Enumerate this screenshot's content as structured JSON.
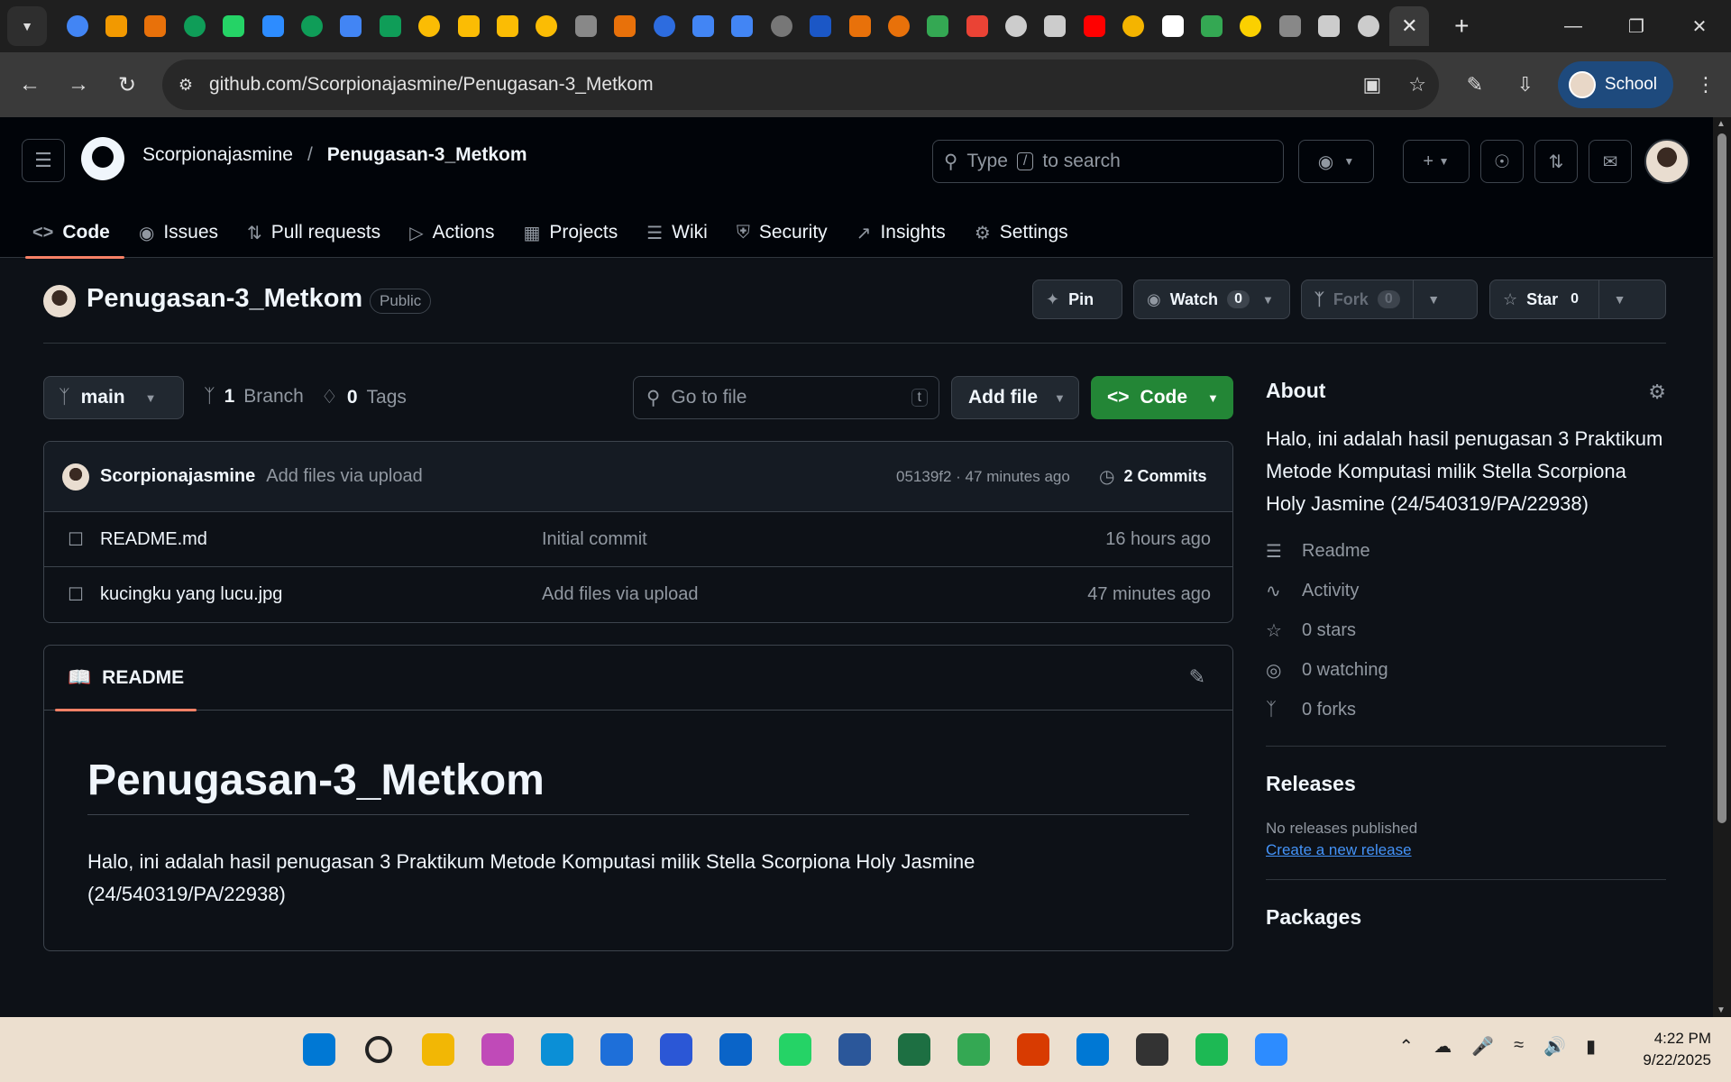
{
  "browser": {
    "url": "github.com/Scorpionajasmine/Penugasan-3_Metkom",
    "profile_label": "School",
    "tab_favicon_colors": [
      "#4285f4",
      "#f29900",
      "#e8710a",
      "#0f9d58",
      "#25d366",
      "#2d8cff",
      "#0f9d58",
      "#4285f4",
      "#0f9d58",
      "#fbbc04",
      "#fbbc04",
      "#fbbc04",
      "#fbbc04",
      "#888888",
      "#e8710a",
      "#2d6cdf",
      "#4285f4",
      "#4285f4",
      "#777777",
      "#1b57c6",
      "#e8710a",
      "#e8710a",
      "#34a853",
      "#ea4335",
      "#cccccc",
      "#cccccc",
      "#ff0000",
      "#f4b400",
      "#ffffff",
      "#34a853",
      "#fbd000",
      "#888888",
      "#cccccc",
      "#cccccc"
    ]
  },
  "github": {
    "owner": "Scorpionajasmine",
    "separator": "/",
    "repo": "Penugasan-3_Metkom",
    "search_before": "Type",
    "search_key": "/",
    "search_after": "to search",
    "nav": [
      {
        "label": "Code",
        "icon": "code-icon"
      },
      {
        "label": "Issues",
        "icon": "issue-icon"
      },
      {
        "label": "Pull requests",
        "icon": "pull-request-icon"
      },
      {
        "label": "Actions",
        "icon": "play-icon"
      },
      {
        "label": "Projects",
        "icon": "table-icon"
      },
      {
        "label": "Wiki",
        "icon": "book-icon"
      },
      {
        "label": "Security",
        "icon": "shield-icon"
      },
      {
        "label": "Insights",
        "icon": "graph-icon"
      },
      {
        "label": "Settings",
        "icon": "gear-icon"
      }
    ]
  },
  "repo": {
    "title": "Penugasan-3_Metkom",
    "visibility": "Public",
    "pin_label": "Pin",
    "watch_label": "Watch",
    "watch_count": "0",
    "fork_label": "Fork",
    "fork_count": "0",
    "star_label": "Star",
    "star_count": "0"
  },
  "files_toolbar": {
    "branch": "main",
    "branch_count": "1",
    "branch_label": "Branch",
    "tag_count": "0",
    "tag_label": "Tags",
    "goto_placeholder": "Go to file",
    "goto_key": "t",
    "add_file": "Add file",
    "code": "Code"
  },
  "latest_commit": {
    "author": "Scorpionajasmine",
    "message": "Add files via upload",
    "hash_time": "05139f2 · 47 minutes ago",
    "commits": "2 Commits"
  },
  "files": [
    {
      "name": "README.md",
      "message": "Initial commit",
      "time": "16 hours ago"
    },
    {
      "name": "kucingku yang lucu.jpg",
      "message": "Add files via upload",
      "time": "47 minutes ago"
    }
  ],
  "readme": {
    "tab": "README",
    "heading": "Penugasan-3_Metkom",
    "body": "Halo, ini adalah hasil penugasan 3 Praktikum Metode Komputasi milik Stella Scorpiona Holy Jasmine (24/540319/PA/22938)"
  },
  "about": {
    "title": "About",
    "description": "Halo, ini adalah hasil penugasan 3 Praktikum Metode Komputasi milik Stella Scorpiona Holy Jasmine (24/540319/PA/22938)",
    "stats": [
      {
        "label": "Readme",
        "icon": "book-icon"
      },
      {
        "label": "Activity",
        "icon": "pulse-icon"
      },
      {
        "label": "0 stars",
        "icon": "star-icon"
      },
      {
        "label": "0 watching",
        "icon": "eye-icon"
      },
      {
        "label": "0 forks",
        "icon": "fork-icon"
      }
    ],
    "releases_title": "Releases",
    "releases_text": "No releases published",
    "releases_link": "Create a new release",
    "packages_title": "Packages"
  },
  "taskbar": {
    "app_colors": [
      "#0078d4",
      "#222222",
      "#f2b705",
      "#c04ab8",
      "#0b8fd6",
      "#1e6fd9",
      "#2b57d6",
      "#0a64c8",
      "#25d366",
      "#2b579a",
      "#1d6f42",
      "#34a853",
      "#d83b01",
      "#0078d4",
      "#333333",
      "#1db954",
      "#2d8cff"
    ],
    "time": "4:22 PM",
    "date": "9/22/2025"
  }
}
